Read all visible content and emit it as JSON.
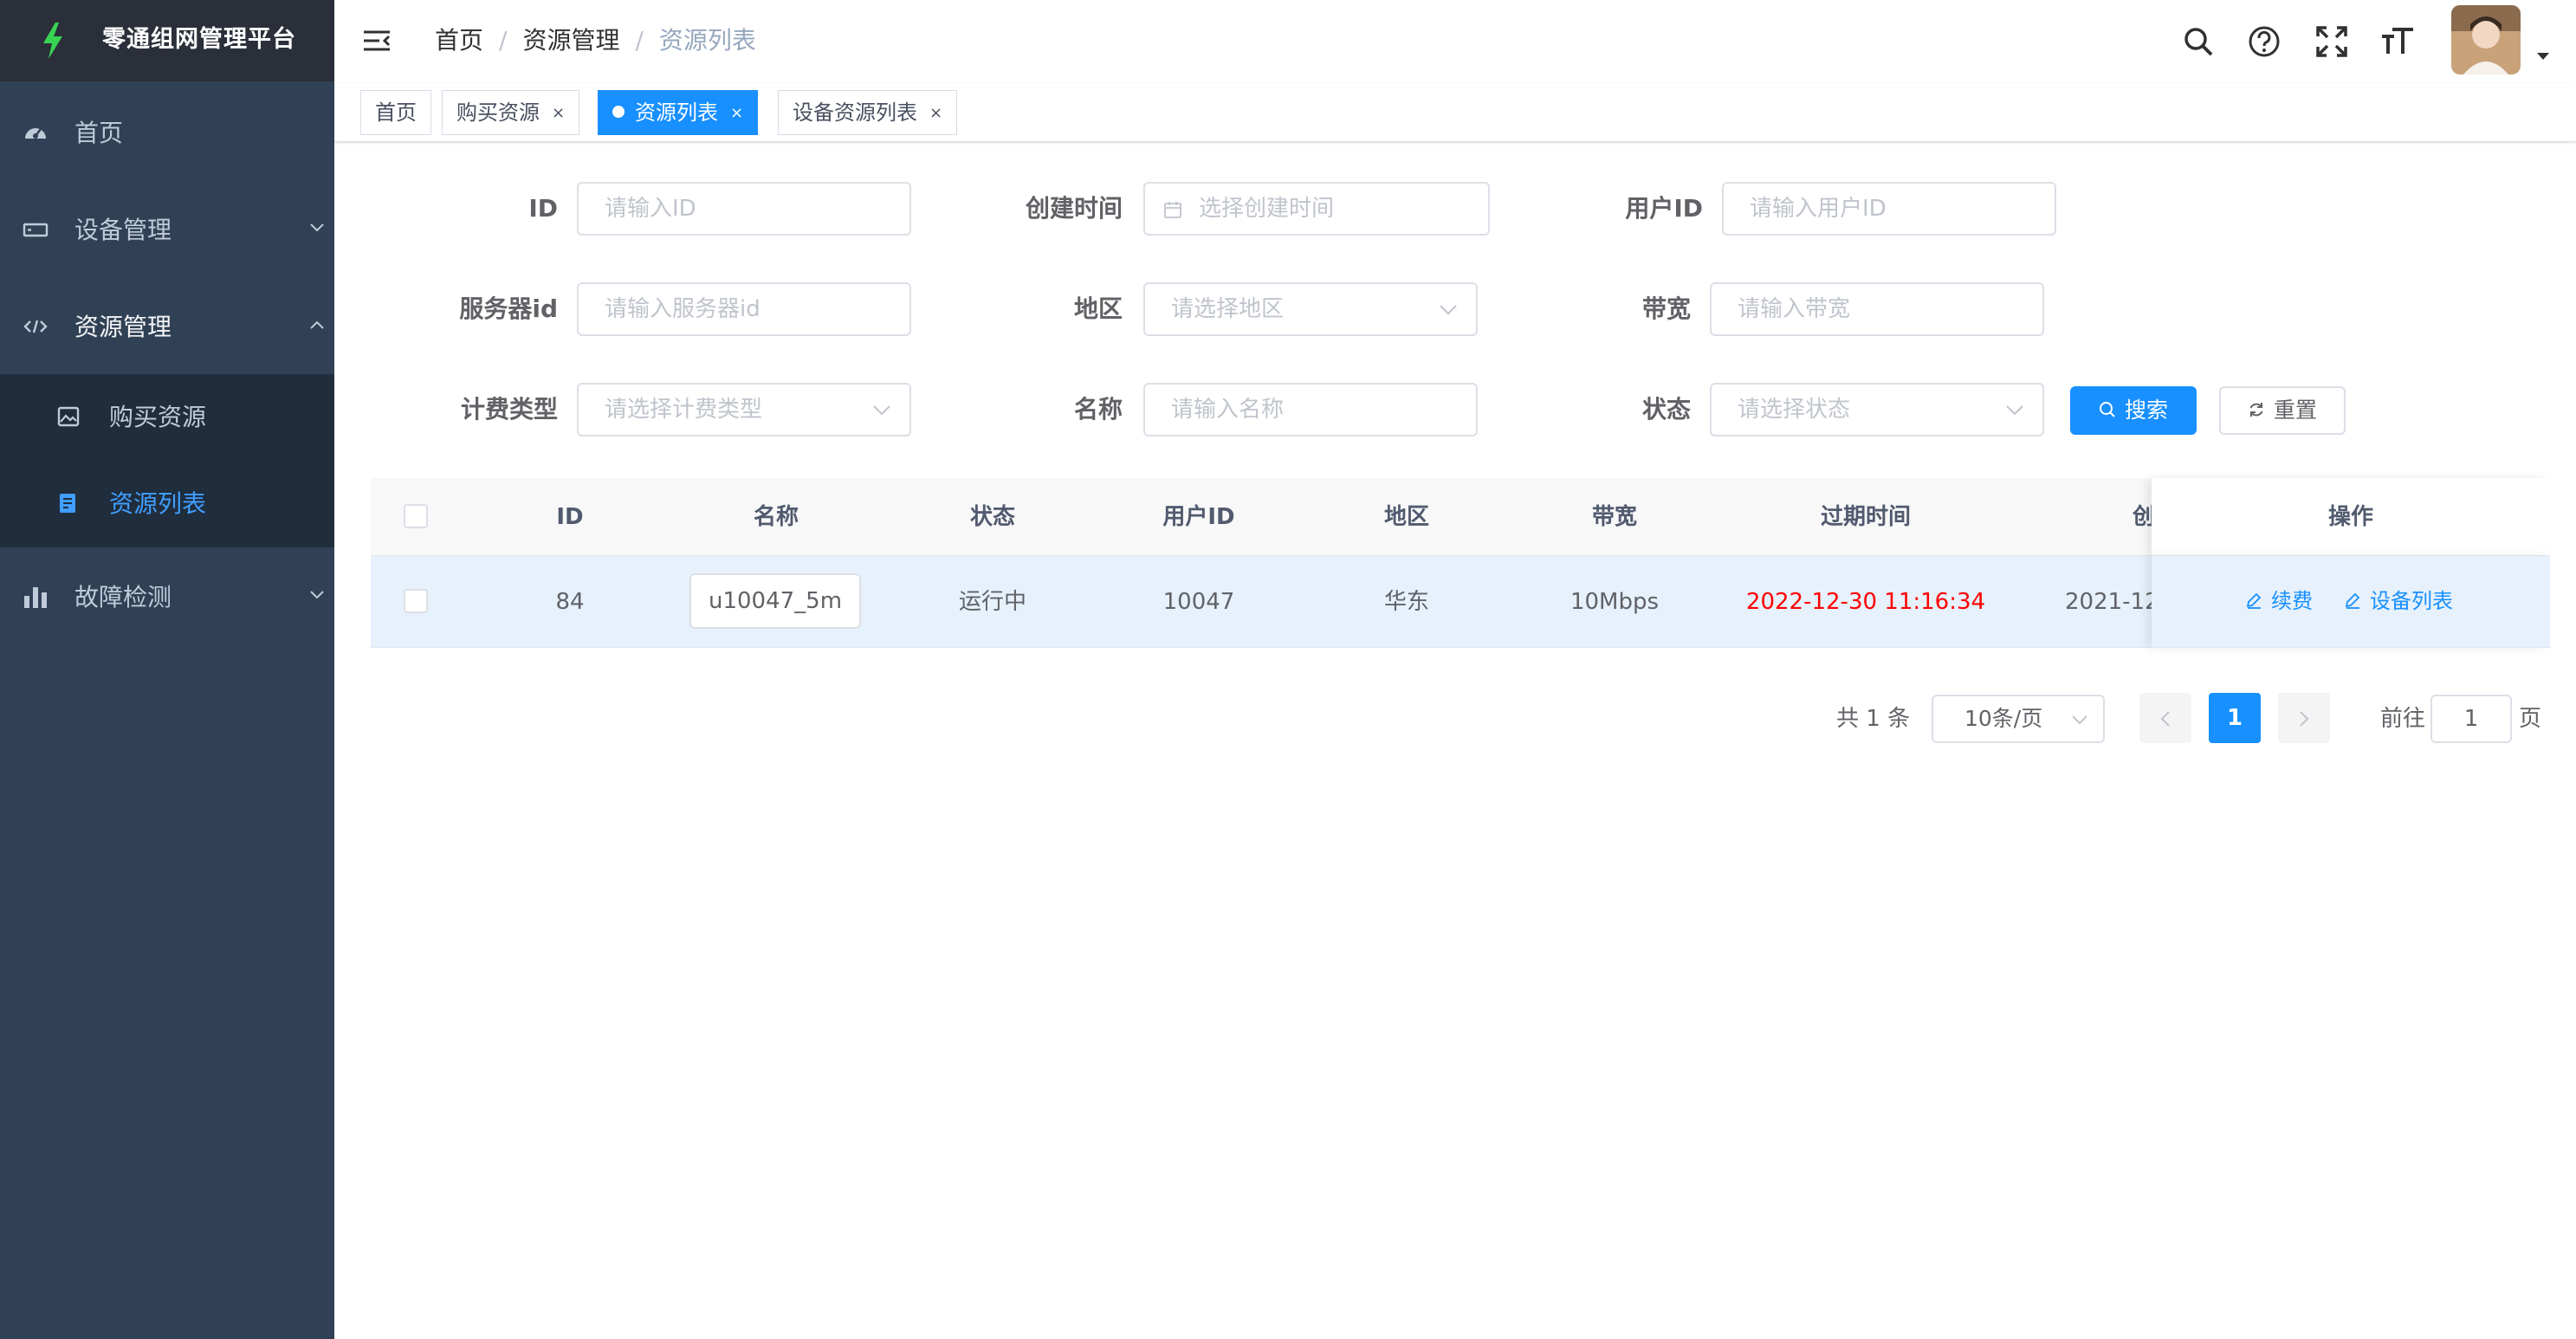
{
  "app": {
    "title": "零通组网管理平台"
  },
  "sidebar": {
    "items": [
      {
        "label": "首页",
        "icon": "dashboard-icon"
      },
      {
        "label": "设备管理",
        "icon": "device-icon"
      },
      {
        "label": "资源管理",
        "icon": "code-icon"
      },
      {
        "label": "故障检测",
        "icon": "chart-icon"
      }
    ],
    "subitems": [
      {
        "label": "购买资源",
        "icon": "image-icon"
      },
      {
        "label": "资源列表",
        "icon": "list-icon"
      }
    ]
  },
  "breadcrumb": {
    "home": "首页",
    "parent": "资源管理",
    "current": "资源列表",
    "separator": "/"
  },
  "tags": [
    {
      "label": "首页"
    },
    {
      "label": "购买资源",
      "close": "×"
    },
    {
      "label": "资源列表",
      "close": "×"
    },
    {
      "label": "设备资源列表",
      "close": "×"
    }
  ],
  "form": {
    "id": {
      "label": "ID",
      "placeholder": "请输入ID"
    },
    "created": {
      "label": "创建时间",
      "placeholder": "选择创建时间"
    },
    "user_id": {
      "label": "用户ID",
      "placeholder": "请输入用户ID"
    },
    "server_id": {
      "label": "服务器id",
      "placeholder": "请输入服务器id"
    },
    "region": {
      "label": "地区",
      "placeholder": "请选择地区"
    },
    "bandwidth": {
      "label": "带宽",
      "placeholder": "请输入带宽"
    },
    "billing": {
      "label": "计费类型",
      "placeholder": "请选择计费类型"
    },
    "name": {
      "label": "名称",
      "placeholder": "请输入名称"
    },
    "status": {
      "label": "状态",
      "placeholder": "请选择状态"
    },
    "search_label": "搜索",
    "reset_label": "重置"
  },
  "table": {
    "columns": [
      "ID",
      "名称",
      "状态",
      "用户ID",
      "地区",
      "带宽",
      "过期时间",
      "创",
      "操作"
    ],
    "rows": [
      {
        "id": "84",
        "name": "u10047_5m",
        "status": "运行中",
        "user_id": "10047",
        "region": "华东",
        "bandwidth": "10Mbps",
        "expire": "2022-12-30 11:16:34",
        "created": "2021-12"
      }
    ],
    "actions": {
      "renew": "续费",
      "device_list": "设备列表"
    }
  },
  "pagination": {
    "total": "共 1 条",
    "page_size": "10条/页",
    "current_page": "1",
    "goto_prefix": "前往",
    "goto_value": "1",
    "goto_suffix": "页"
  },
  "colors": {
    "primary": "#1890ff",
    "sidebar": "#304156",
    "danger": "#ff0000"
  }
}
